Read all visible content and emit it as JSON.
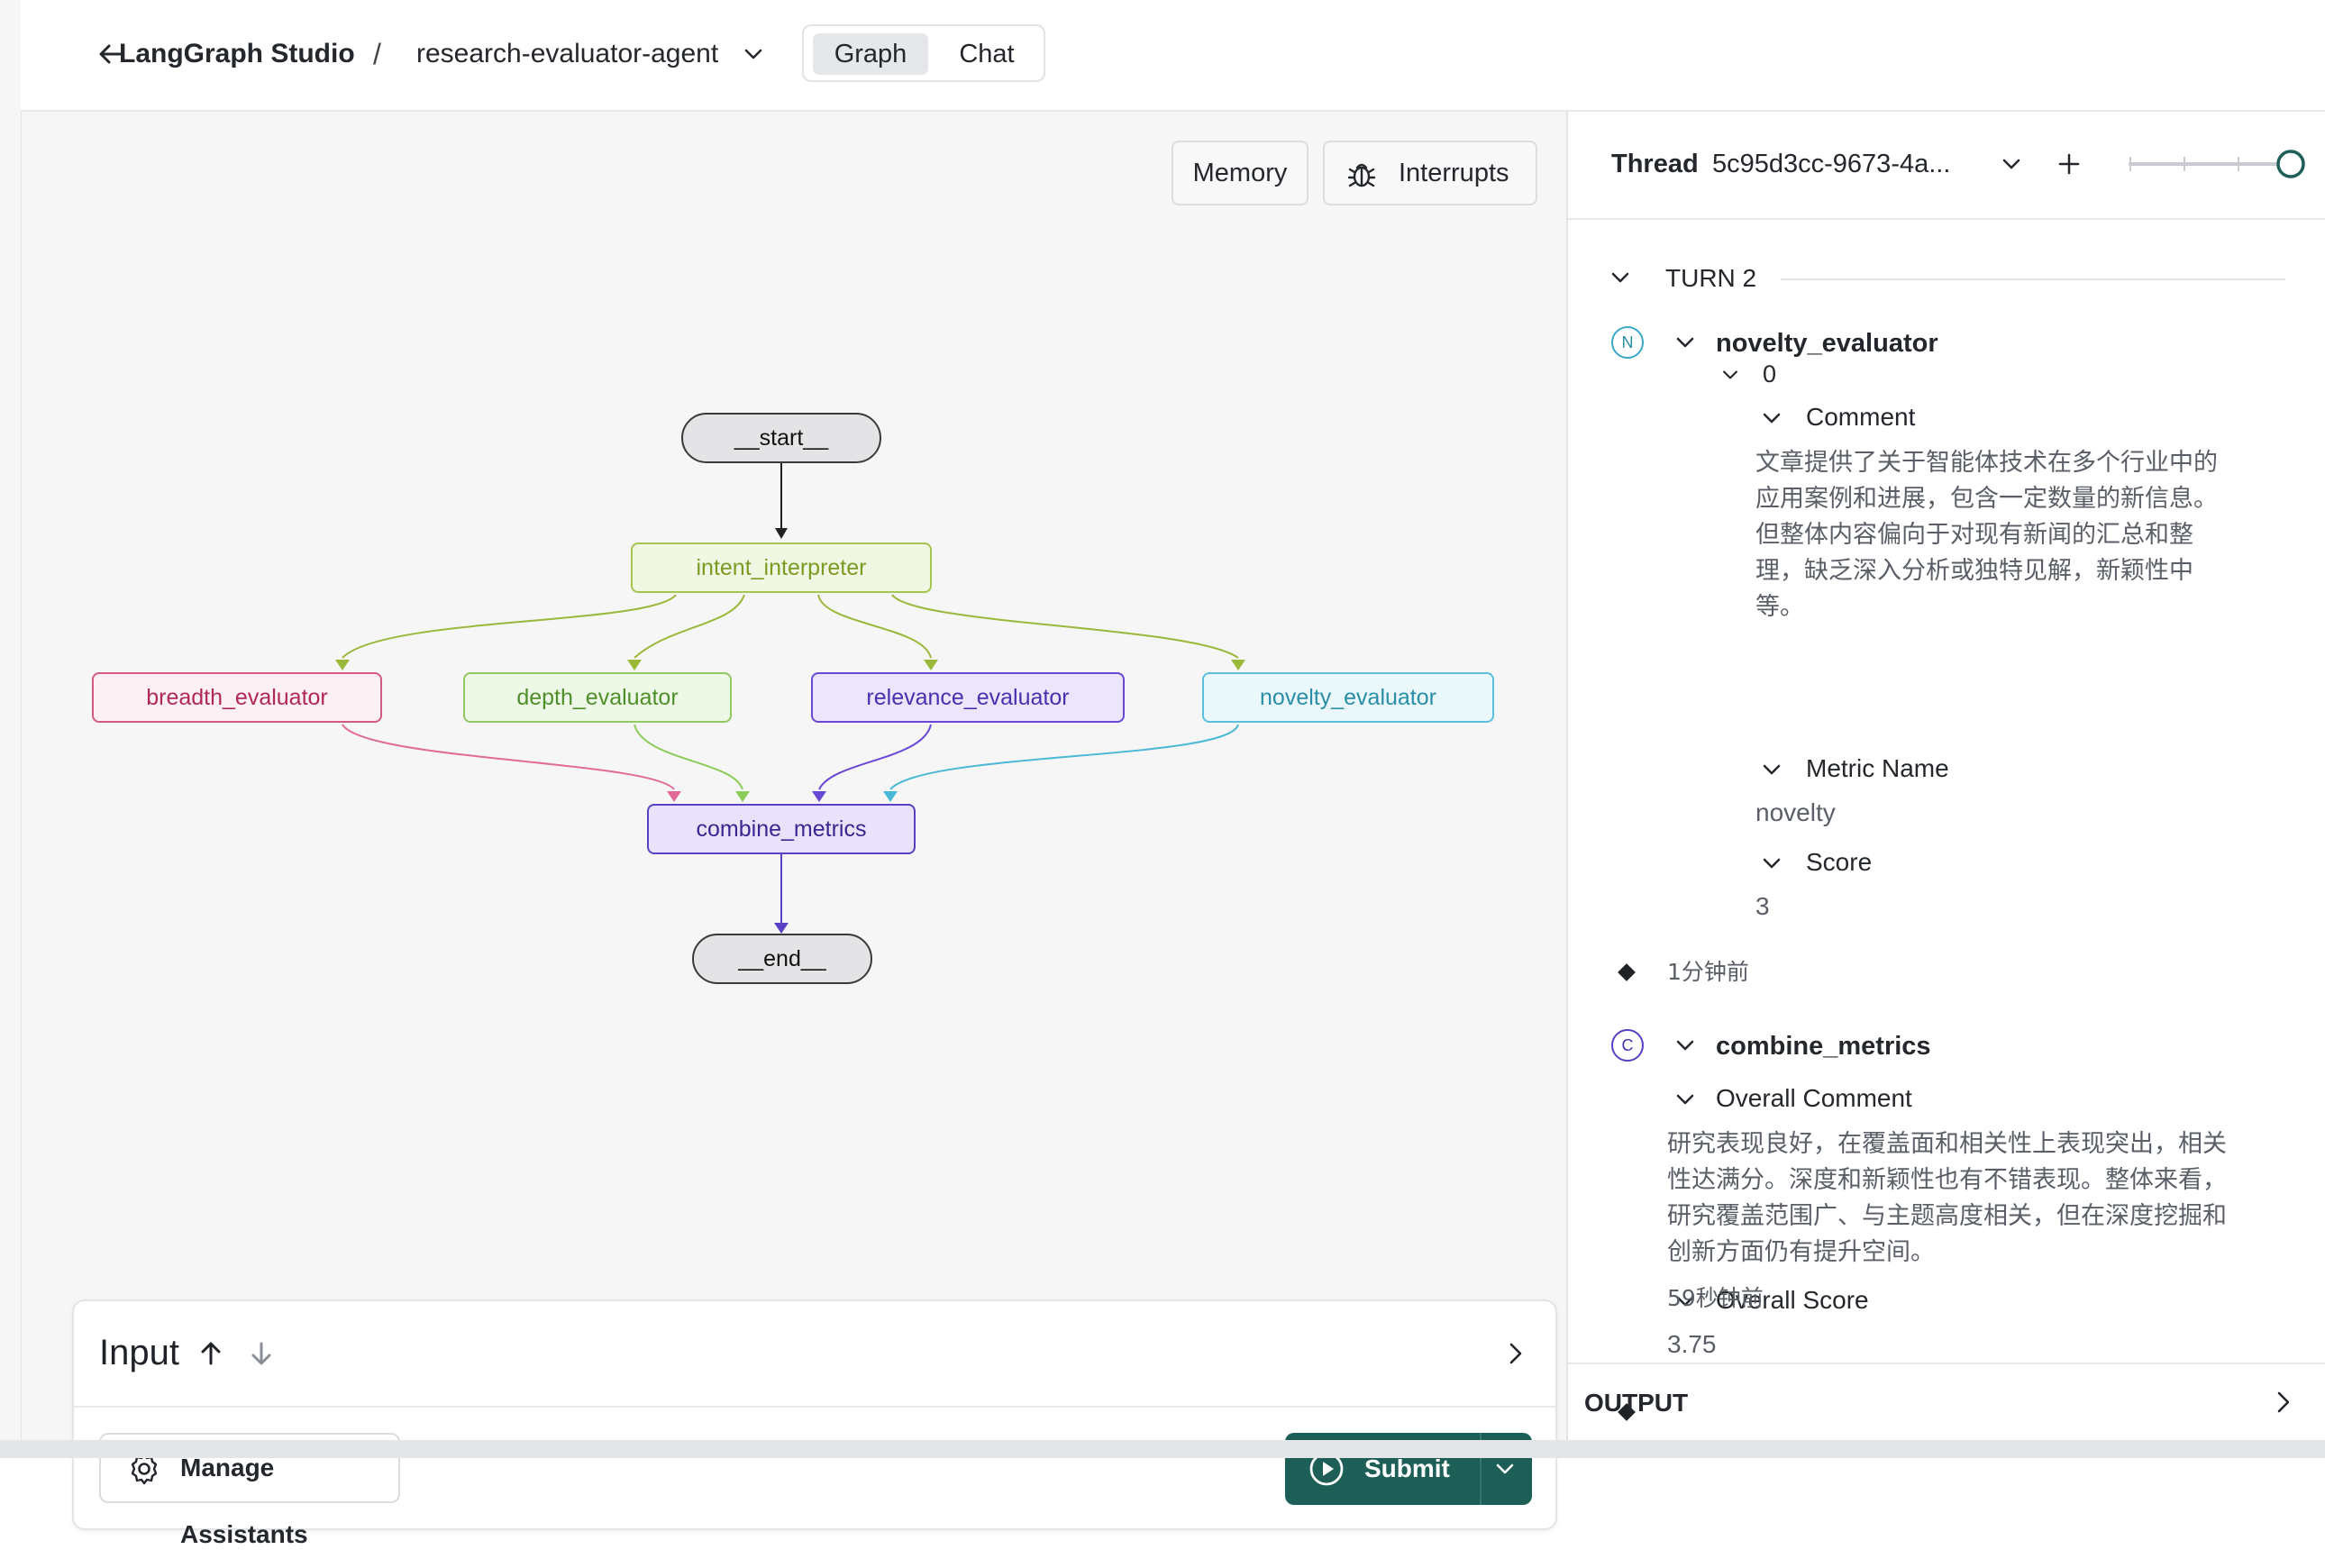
{
  "header": {
    "app_title": "LangGraph Studio",
    "separator": "/",
    "agent_name": "research-evaluator-agent",
    "tabs": [
      {
        "label": "Graph",
        "active": true
      },
      {
        "label": "Chat",
        "active": false
      }
    ]
  },
  "canvas": {
    "toolbar": {
      "memory_label": "Memory",
      "interrupts_label": "Interrupts"
    },
    "nodes": {
      "start": "__start__",
      "intent_interpreter": "intent_interpreter",
      "breadth_evaluator": "breadth_evaluator",
      "depth_evaluator": "depth_evaluator",
      "relevance_evaluator": "relevance_evaluator",
      "novelty_evaluator": "novelty_evaluator",
      "combine_metrics": "combine_metrics",
      "end": "__end__"
    },
    "colors": {
      "intent": "#8aab2c",
      "breadth": "#c63b6c",
      "depth": "#7fbf4b",
      "relevance": "#5b3fc4",
      "novelty": "#3aa9c8",
      "combine": "#4a2fb0"
    }
  },
  "input_panel": {
    "title": "Input",
    "manage_assistants_label": "Manage Assistants",
    "submit_label": "Submit"
  },
  "right_panel": {
    "thread_label": "Thread",
    "thread_id": "5c95d3cc-9673-4a...",
    "turn_label": "TURN 2",
    "novelty": {
      "badge": "N",
      "name": "novelty_evaluator",
      "index": "0",
      "comment_label": "Comment",
      "comment_lines": [
        "文章提供了关于智能体技术在多个行业中的",
        "应用案例和进展，包含一定数量的新信息。",
        "但整体内容偏向于对现有新闻的汇总和整",
        "理，缺乏深入分析或独特见解，新颖性中",
        "等。"
      ],
      "metric_name_label": "Metric Name",
      "metric_name_value": "novelty",
      "score_label": "Score",
      "score_value": "3",
      "timestamp": "1分钟前"
    },
    "combine": {
      "badge": "C",
      "name": "combine_metrics",
      "overall_comment_label": "Overall Comment",
      "overall_comment_lines": [
        "研究表现良好，在覆盖面和相关性上表现突出，相关",
        "性达满分。深度和新颖性也有不错表现。整体来看，",
        "研究覆盖范围广、与主题高度相关，但在深度挖掘和",
        "创新方面仍有提升空间。"
      ],
      "overall_score_label": "Overall Score",
      "overall_score_value": "3.75",
      "timestamp": "59秒钟前"
    },
    "output_label": "OUTPUT"
  }
}
